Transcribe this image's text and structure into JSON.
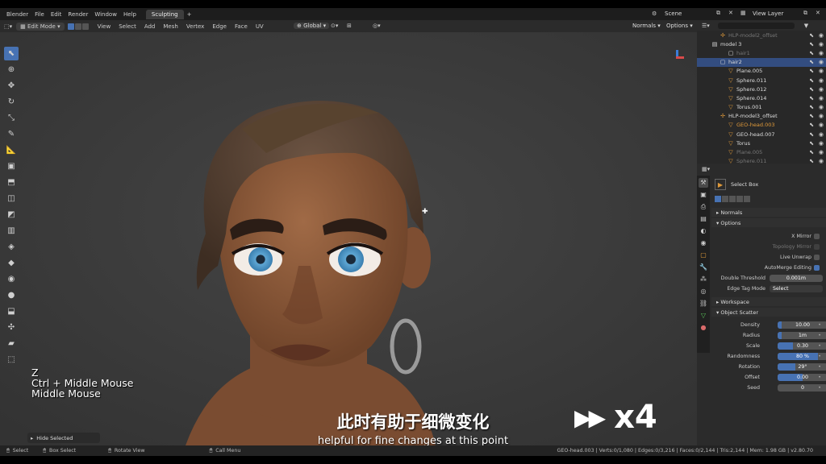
{
  "menu": {
    "items": [
      "Blender",
      "File",
      "Edit",
      "Render",
      "Window",
      "Help"
    ],
    "active_workspace": "Sculpting",
    "add_tab": "+",
    "scene_label": "Scene",
    "view_layer_label": "View Layer"
  },
  "viewport_header": {
    "mode": "Edit Mode",
    "menus": [
      "View",
      "Select",
      "Add",
      "Mesh",
      "Vertex",
      "Edge",
      "Face",
      "UV"
    ],
    "transform_orientation": "Global",
    "overlay_normals": "Normals",
    "options_label": "Options"
  },
  "toolbar": {
    "tools": [
      {
        "name": "select-box-tool",
        "icon": "cursor-arrow-icon",
        "glyph": "⬉",
        "active": true
      },
      {
        "name": "cursor-tool",
        "icon": "3d-cursor-icon",
        "glyph": "⊕"
      },
      {
        "name": "move-tool",
        "icon": "move-arrows-icon",
        "glyph": "✥"
      },
      {
        "name": "rotate-tool",
        "icon": "rotate-icon",
        "glyph": "↻"
      },
      {
        "name": "scale-tool",
        "icon": "scale-icon",
        "glyph": "⤡"
      },
      {
        "name": "annotate-tool",
        "icon": "pencil-icon",
        "glyph": "✎"
      },
      {
        "name": "measure-tool",
        "icon": "ruler-icon",
        "glyph": "📐"
      },
      {
        "name": "add-cube-tool",
        "icon": "add-cube-icon",
        "glyph": "▣"
      },
      {
        "name": "extrude-tool",
        "icon": "extrude-icon",
        "glyph": "⬒"
      },
      {
        "name": "inset-tool",
        "icon": "inset-icon",
        "glyph": "◫"
      },
      {
        "name": "bevel-tool",
        "icon": "bevel-icon",
        "glyph": "◩"
      },
      {
        "name": "loop-cut-tool",
        "icon": "loop-cut-icon",
        "glyph": "▥"
      },
      {
        "name": "knife-tool",
        "icon": "knife-icon",
        "glyph": "◈"
      },
      {
        "name": "poly-build-tool",
        "icon": "poly-build-icon",
        "glyph": "◆"
      },
      {
        "name": "spin-tool",
        "icon": "spin-icon",
        "glyph": "◉"
      },
      {
        "name": "smooth-tool",
        "icon": "smooth-icon",
        "glyph": "●"
      },
      {
        "name": "edge-slide-tool",
        "icon": "edge-slide-icon",
        "glyph": "⬓"
      },
      {
        "name": "shrink-fatten-tool",
        "icon": "shrink-fatten-icon",
        "glyph": "✣"
      },
      {
        "name": "shear-tool",
        "icon": "shear-icon",
        "glyph": "▰"
      },
      {
        "name": "rip-tool",
        "icon": "rip-icon",
        "glyph": "⬚"
      }
    ]
  },
  "outliner": {
    "rows": [
      {
        "label": "HLP-model2_offset",
        "icon": "empty-icon",
        "glyph": "✢",
        "indent": 1,
        "dim": true
      },
      {
        "label": "model 3",
        "icon": "collection-icon",
        "glyph": "▤",
        "indent": 0
      },
      {
        "label": "hair1",
        "icon": "collection-icon",
        "glyph": "▢",
        "indent": 2,
        "dim": true
      },
      {
        "label": "hair2",
        "icon": "collection-icon",
        "glyph": "▢",
        "indent": 1,
        "selected": true
      },
      {
        "label": "Plane.005",
        "icon": "mesh-icon",
        "glyph": "▽",
        "indent": 2
      },
      {
        "label": "Sphere.011",
        "icon": "mesh-icon",
        "glyph": "▽",
        "indent": 2
      },
      {
        "label": "Sphere.012",
        "icon": "mesh-icon",
        "glyph": "▽",
        "indent": 2
      },
      {
        "label": "Sphere.014",
        "icon": "mesh-icon",
        "glyph": "▽",
        "indent": 2
      },
      {
        "label": "Torus.001",
        "icon": "mesh-icon",
        "glyph": "▽",
        "indent": 2
      },
      {
        "label": "HLP-model3_offset",
        "icon": "empty-icon",
        "glyph": "✢",
        "indent": 1
      },
      {
        "label": "GEO-head.003",
        "icon": "mesh-icon",
        "glyph": "▽",
        "indent": 2,
        "orange": true
      },
      {
        "label": "GEO-head.007",
        "icon": "mesh-icon",
        "glyph": "▽",
        "indent": 2
      },
      {
        "label": "Torus",
        "icon": "mesh-icon",
        "glyph": "▽",
        "indent": 2
      },
      {
        "label": "Plane.005",
        "icon": "mesh-icon",
        "glyph": "▽",
        "indent": 2,
        "dim": true
      },
      {
        "label": "Sphere.011",
        "icon": "mesh-icon",
        "glyph": "▽",
        "indent": 2,
        "dim": true
      }
    ]
  },
  "properties": {
    "tool_name": "Select Box",
    "panels": {
      "normals": "Normals",
      "options": "Options",
      "workspace": "Workspace",
      "object_scatter": "Object Scatter"
    },
    "options": {
      "x_mirror": "X Mirror",
      "topology_mirror": "Topology Mirror",
      "live_unwrap": "Live Unwrap",
      "automerge": "AutoMerge Editing",
      "double_threshold_label": "Double Threshold",
      "double_threshold_value": "0.001m",
      "edge_tag_label": "Edge Tag Mode",
      "edge_tag_value": "Select"
    },
    "scatter": [
      {
        "label": "Density",
        "value": "10.00",
        "fill": 0.08
      },
      {
        "label": "Radius",
        "value": "1m",
        "fill": 0.08
      },
      {
        "label": "Scale",
        "value": "0.30",
        "fill": 0.3
      },
      {
        "label": "Randomness",
        "value": "80 %",
        "fill": 0.8
      },
      {
        "label": "Rotation",
        "value": "29°",
        "fill": 0.35
      },
      {
        "label": "Offset",
        "value": "0.00",
        "fill": 0.5
      },
      {
        "label": "Seed",
        "value": "0",
        "fill": 0
      }
    ]
  },
  "overlay": {
    "keys": [
      "Z",
      "Ctrl + Middle Mouse",
      "Middle Mouse"
    ],
    "hide_selected": "Hide Selected",
    "speed": "x4",
    "subtitle_cn": "此时有助于细微变化",
    "subtitle_en": "helpful for fine changes at this point"
  },
  "statusbar": {
    "select": "Select",
    "box_select": "Box Select",
    "rotate_view": "Rotate View",
    "call_menu": "Call Menu",
    "stats": "GEO-head.003 | Verts:0/1,080 | Edges:0/3,216 | Faces:0/2,144 | Tris:2,144 | Mem: 1.98 GB | v2.80.70"
  },
  "colors": {
    "accent": "#4772b3",
    "viewport_bg": "#3a3a3a",
    "skin": "#8a5a3c",
    "hair": "#5b4535",
    "iris": "#5fa7d4"
  }
}
